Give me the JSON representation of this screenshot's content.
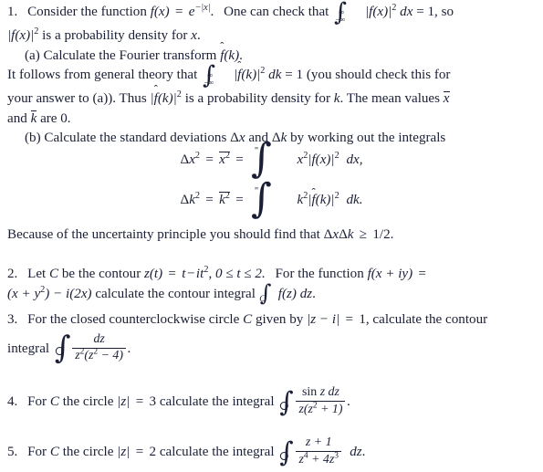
{
  "document": {
    "type": "math-problem-set",
    "background_color": "#ffffff",
    "text_color": "#1b1f35"
  },
  "problem1": {
    "number": "1.",
    "line1_a": "Consider the function",
    "func_f": "f",
    "func_arg": "(x)",
    "equals": "=",
    "exp_base": "e",
    "exp_power": "−|x|",
    "line1_b": "One can check that",
    "int_lower": "−∞",
    "int_upper": "∞",
    "integrand1": "|f(x)|",
    "integrand1_sup": "2",
    "diff_dx": "dx",
    "eq_one": "= 1,",
    "line1_c": "so",
    "line2": "is a probability density for",
    "var_x": "x",
    "period": ".",
    "parta": {
      "label": "(a)",
      "text": "Calculate the Fourier transform",
      "fhat": "f",
      "hat": "̂",
      "arg_k": "(k)",
      "end": "."
    },
    "line3_a": "It follows from general theory that",
    "integrand2": "|f(k)|",
    "diff_dk": "dk",
    "eq_one_b": "= 1",
    "line3_b": "(you should check this for",
    "line4_a": "your answer to (a)). Thus",
    "line4_b": "is a probability density for",
    "var_k": "k",
    "line4_c": ". The mean values",
    "mean_x": "x",
    "line5": "and",
    "mean_k": "k",
    "line5_b": "are 0.",
    "partb": {
      "label": "(b)",
      "text": "Calculate the standard deviations",
      "delta_x": "Δx",
      "and": "and",
      "delta_k": "Δk",
      "text2": "by working out the integrals"
    },
    "eq1": {
      "lhs1": "Δx",
      "lhs1_sup": "2",
      "eq": "=",
      "lhs2": "x",
      "lhs2_sup": "2",
      "eq2": "=",
      "lower": "−∞",
      "upper": "∞",
      "integrand_var": "x",
      "integrand_sup": "2",
      "integrand_body": "|f(x)|",
      "integrand_body_sup": "2",
      "differential": "dx,"
    },
    "eq2": {
      "lhs1": "Δk",
      "lhs1_sup": "2",
      "eq": "=",
      "lhs2": "k",
      "lhs2_sup": "2",
      "eq2": "=",
      "lower": "−∞",
      "upper": "∞",
      "integrand_var": "k",
      "integrand_sup": "2",
      "integrand_body": "|f(k)|",
      "integrand_body_sup": "2",
      "differential": "dk."
    },
    "uncertainty": {
      "text": "Because of the uncertainty principle you should find that",
      "formula": "ΔxΔk",
      "geq": "≥",
      "value": "1/2."
    }
  },
  "problem2": {
    "number": "2.",
    "text1": "Let",
    "var_C": "C",
    "text2": "be the contour",
    "z_t": "z(t)",
    "eq": "=",
    "rhs_t": "t",
    "minus": "−",
    "rhs_it": "it",
    "rhs_sup": "2",
    "comma": ",",
    "range": "0 ≤ t ≤ 2.",
    "text3": "For the function",
    "f_xiy": "f(x + iy)",
    "eq2": "=",
    "line2_expr": "(x + y",
    "line2_sup": "2",
    "line2_expr_b": ") − i(2x)",
    "text4": "calculate the contour integral",
    "int_sub": "C",
    "integrand": "f(z) dz",
    "period": "."
  },
  "problem3": {
    "number": "3.",
    "text1": "For the closed counterclockwise circle",
    "var_C": "C",
    "text2": "given by",
    "condition": "|z − i|",
    "eq": "=",
    "value": "1,",
    "text3": "calculate the contour",
    "text4": "integral",
    "frac_num": "dz",
    "frac_den_a": "z",
    "frac_den_sup": "2",
    "frac_den_b": "(z",
    "frac_den_sup2": "2",
    "frac_den_c": " − 4)",
    "period": "."
  },
  "problem4": {
    "number": "4.",
    "text1": "For",
    "var_C": "C",
    "text2": "the circle",
    "condition": "|z|",
    "eq": "=",
    "value": "3",
    "text3": "calculate the integral",
    "frac_num": "sin z dz",
    "frac_den_a": "z(z",
    "frac_den_sup": "2",
    "frac_den_b": " + 1)",
    "period": "."
  },
  "problem5": {
    "number": "5.",
    "text1": "For",
    "var_C": "C",
    "text2": "the circle",
    "condition": "|z|",
    "eq": "=",
    "value": "2",
    "text3": "calculate the integral",
    "frac_num": "z + 1",
    "frac_den_a": "z",
    "frac_den_sup": "4",
    "frac_den_b": " + 4z",
    "frac_den_sup2": "3",
    "differential": "dz",
    "period": "."
  }
}
